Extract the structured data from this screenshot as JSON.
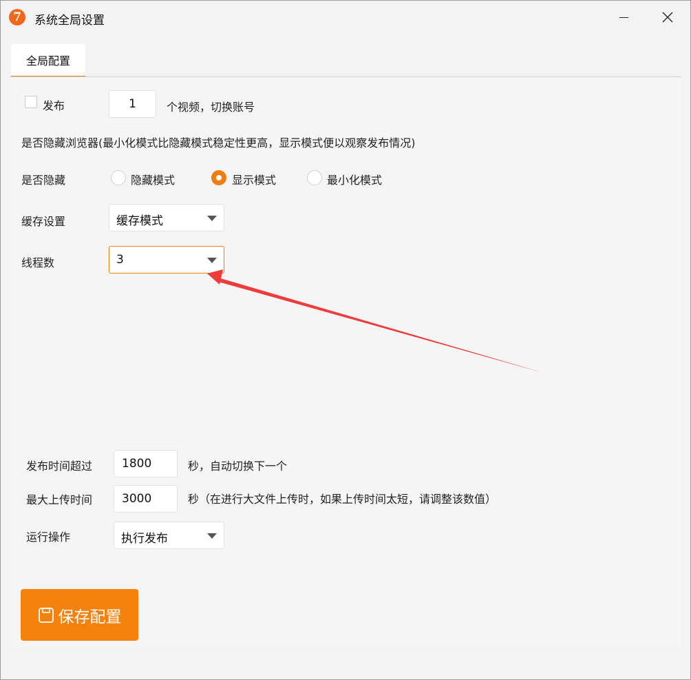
{
  "window": {
    "title": "系统全局设置",
    "logo_text": "7"
  },
  "tabs": [
    {
      "label": "全局配置",
      "active": true
    }
  ],
  "publish": {
    "checkbox_label": "发布",
    "count_value": "1",
    "count_suffix": "个视频，切换账号"
  },
  "hide_browser": {
    "description": "是否隐藏浏览器(最小化模式比隐藏模式稳定性更高，显示模式便以观察发布情况)",
    "label": "是否隐藏",
    "options": [
      {
        "label": "隐藏模式",
        "checked": false
      },
      {
        "label": "显示模式",
        "checked": true
      },
      {
        "label": "最小化模式",
        "checked": false
      }
    ]
  },
  "cache": {
    "label": "缓存设置",
    "value": "缓存模式"
  },
  "threads": {
    "label": "线程数",
    "value": "3"
  },
  "publish_timeout": {
    "label": "发布时间超过",
    "value": "1800",
    "suffix": "秒，自动切换下一个"
  },
  "max_upload": {
    "label": "最大上传时间",
    "value": "3000",
    "suffix": "秒（在进行大文件上传时，如果上传时间太短，请调整该数值）"
  },
  "run_action": {
    "label": "运行操作",
    "value": "执行发布"
  },
  "save_button": {
    "label": "保存配置"
  },
  "colors": {
    "accent": "#f07d12",
    "button": "#f5820c",
    "annotation_arrow": "#ee3b3b",
    "logo": "#ee6a1a"
  }
}
